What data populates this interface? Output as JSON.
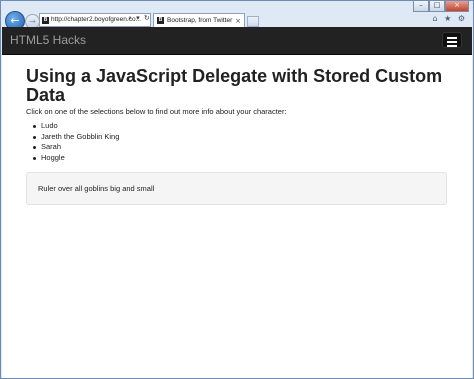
{
  "browser": {
    "address_url": "http://chapter2.boyofgreen.co...",
    "address_icons": "⌕ ▾ ↻",
    "tab_title": "Bootstrap, from Twitter",
    "tab_close": "×",
    "favicon_letter": "B",
    "back_glyph": "←",
    "forward_glyph": "→",
    "right_icons": "⌂ ★ ⚙",
    "caption": {
      "minimize": "–",
      "maximize": "□",
      "close": "×"
    }
  },
  "navbar": {
    "brand": "HTML5 Hacks"
  },
  "page": {
    "title": "Using a JavaScript Delegate with Stored Custom Data",
    "intro": "Click on one of the selections below to find out more info about your character:",
    "characters": [
      "Ludo",
      "Jareth the Gobblin King",
      "Sarah",
      "Hoggle"
    ],
    "description": "Ruler over all goblins big and small"
  },
  "colors": {
    "navbar_bg": "#222222",
    "brand_text": "#9d9d9d",
    "well_bg": "#f5f5f5"
  }
}
